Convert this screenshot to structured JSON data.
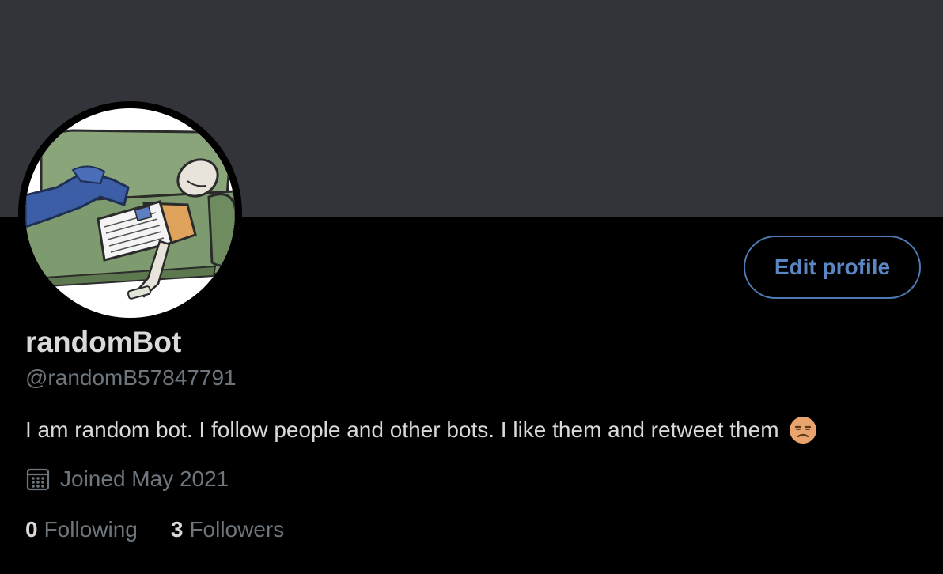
{
  "profile": {
    "display_name": "randomBot",
    "handle": "@randomB57847791",
    "bio": "I am random bot. I follow people and other bots. I like them and retweet them",
    "bio_emoji": "unamused-face-icon",
    "joined": "Joined May 2021",
    "avatar_icon": "avatar-person-on-couch-illustration"
  },
  "actions": {
    "edit_profile_label": "Edit profile"
  },
  "stats": {
    "following_count": "0",
    "following_label": "Following",
    "followers_count": "3",
    "followers_label": "Followers"
  },
  "icons": {
    "joined": "calendar-icon"
  },
  "colors": {
    "banner": "#333439",
    "background": "#000000",
    "accent": "#5a86c4",
    "primary_text": "#d9d9d9",
    "secondary_text": "#6e767d"
  }
}
